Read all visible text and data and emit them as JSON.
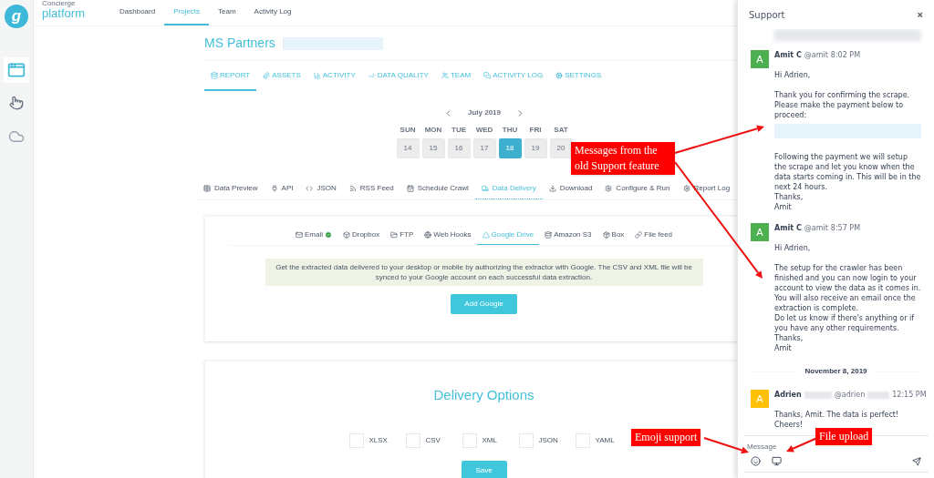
{
  "brand": {
    "small": "Concierge",
    "large": "platform",
    "logo_letter": "g"
  },
  "top_nav": [
    {
      "label": "Dashboard",
      "selected": false
    },
    {
      "label": "Projects",
      "selected": true
    },
    {
      "label": "Team",
      "selected": false
    },
    {
      "label": "Activity Log",
      "selected": false
    }
  ],
  "project": {
    "title": "MS Partners"
  },
  "project_tabs": [
    {
      "label": "REPORT",
      "selected": true
    },
    {
      "label": "ASSETS",
      "selected": false
    },
    {
      "label": "ACTIVITY",
      "selected": false
    },
    {
      "label": "DATA QUALITY",
      "selected": false
    },
    {
      "label": "TEAM",
      "selected": false
    },
    {
      "label": "ACTIVITY LOG",
      "selected": false
    },
    {
      "label": "SETTINGS",
      "selected": false
    }
  ],
  "calendar": {
    "month": "July 2019",
    "days": [
      {
        "name": "SUN",
        "date": "14",
        "selected": false
      },
      {
        "name": "MON",
        "date": "15",
        "selected": false
      },
      {
        "name": "TUE",
        "date": "16",
        "selected": false
      },
      {
        "name": "WED",
        "date": "17",
        "selected": false
      },
      {
        "name": "THU",
        "date": "18",
        "selected": true
      },
      {
        "name": "FRI",
        "date": "19",
        "selected": false
      },
      {
        "name": "SAT",
        "date": "20",
        "selected": false
      }
    ]
  },
  "data_tabs": [
    {
      "label": "Data Preview",
      "selected": false
    },
    {
      "label": "API",
      "selected": false
    },
    {
      "label": "JSON",
      "selected": false
    },
    {
      "label": "RSS Feed",
      "selected": false
    },
    {
      "label": "Schedule Crawl",
      "selected": false
    },
    {
      "label": "Data Delivery",
      "selected": true
    },
    {
      "label": "Download",
      "selected": false
    },
    {
      "label": "Configure & Run",
      "selected": false
    },
    {
      "label": "Report Log",
      "selected": false
    }
  ],
  "delivery_tabs": [
    {
      "label": "Email",
      "selected": false,
      "verified": true
    },
    {
      "label": "Dropbox",
      "selected": false,
      "verified": false
    },
    {
      "label": "FTP",
      "selected": false,
      "verified": false
    },
    {
      "label": "Web Hooks",
      "selected": false,
      "verified": false
    },
    {
      "label": "Google Drive",
      "selected": true,
      "verified": false
    },
    {
      "label": "Amazon S3",
      "selected": false,
      "verified": false
    },
    {
      "label": "Box",
      "selected": false,
      "verified": false
    },
    {
      "label": "File feed",
      "selected": false,
      "verified": false
    }
  ],
  "info": "Get the extracted data delivered to your desktop or mobile by authorizing the extractor with Google. The CSV and XML file will be synced to your Google account on each successful data extraction.",
  "add_button": "Add Google",
  "delivery_options": {
    "title": "Delivery Options",
    "formats": [
      {
        "label": "XLSX",
        "checked": false
      },
      {
        "label": "CSV",
        "checked": false
      },
      {
        "label": "XML",
        "checked": false
      },
      {
        "label": "JSON",
        "checked": false
      },
      {
        "label": "YAML",
        "checked": false
      }
    ],
    "save": "Save"
  },
  "support": {
    "title": "Support",
    "close": "×",
    "messages": [
      {
        "author": "Amit C",
        "handle": "@amit",
        "time": "8:02 PM",
        "avatar": "A",
        "color": "#4caf50",
        "redacted_name": false,
        "parts": [
          {
            "kind": "text",
            "text": "Hi Adrien,"
          },
          {
            "kind": "text",
            "text": "Thank you for confirming the scrape.\nPlease make the payment below to proceed:"
          },
          {
            "kind": "redacted"
          },
          {
            "kind": "text",
            "text": "Following the payment we will setup the scrape and let you know when the data starts coming in. This will be in the next 24 hours.\nThanks,\nAmit"
          }
        ]
      },
      {
        "author": "Amit C",
        "handle": "@amit",
        "time": "8:57 PM",
        "avatar": "A",
        "color": "#4caf50",
        "redacted_name": false,
        "parts": [
          {
            "kind": "text",
            "text": "Hi Adrien,"
          },
          {
            "kind": "text",
            "text": "The setup for the crawler has been finished and you can now login to your account to view the data as it comes in.\nYou will also receive an email once the extraction is complete.\nDo let us know if there's anything or if you have any other requirements.\nThanks,\nAmit"
          }
        ]
      },
      {
        "date_divider": "November 8, 2019",
        "author": "Adrien",
        "handle": "@adrien",
        "time": "12:15 PM",
        "avatar": "A",
        "color": "#ffc107",
        "redacted_name": true,
        "parts": [
          {
            "kind": "text",
            "text": "Thanks, Amit. The data is perfect!\nCheers!"
          }
        ]
      }
    ],
    "placeholder": "Message"
  },
  "annotations": [
    {
      "text": "Messages from the old Support feature"
    },
    {
      "text": "Emoji support"
    },
    {
      "text": "File upload"
    }
  ]
}
